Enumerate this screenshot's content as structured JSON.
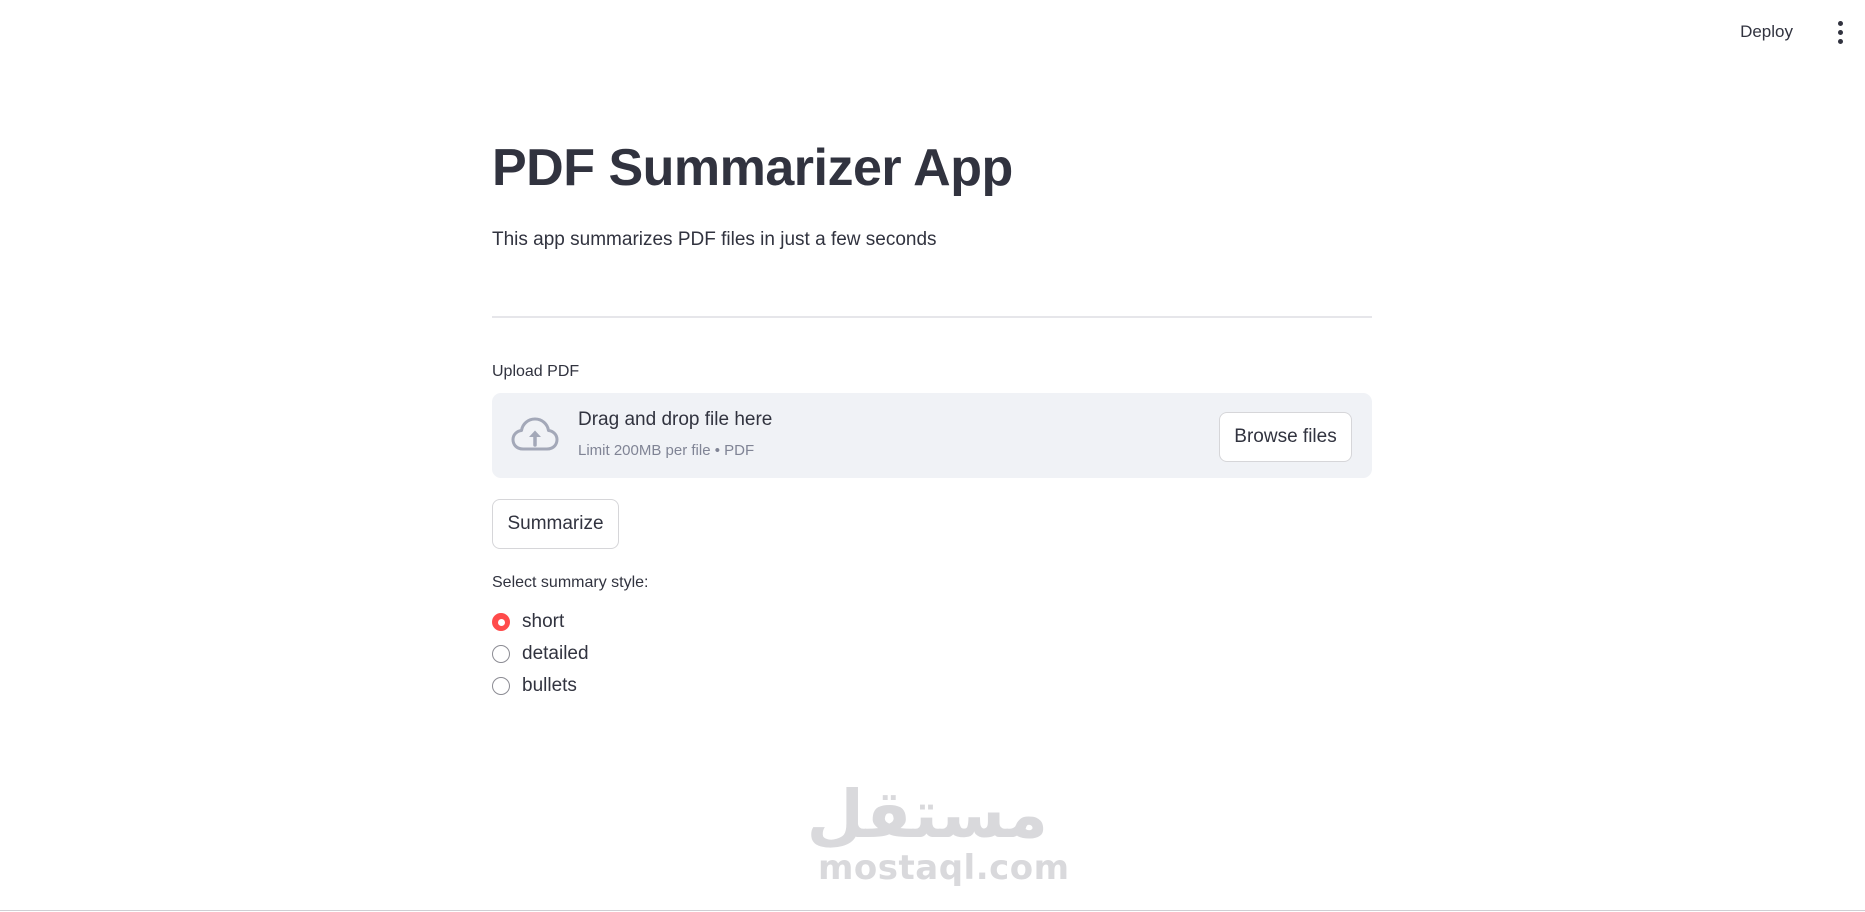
{
  "header": {
    "deploy_label": "Deploy",
    "menu_icon": "vertical-ellipsis-icon"
  },
  "main": {
    "title": "PDF Summarizer App",
    "subtitle": "This app summarizes PDF files in just a few seconds",
    "uploader": {
      "label": "Upload PDF",
      "icon": "cloud-upload-icon",
      "drop_text": "Drag and drop file here",
      "limit_text": "Limit 200MB per file • PDF",
      "browse_label": "Browse files"
    },
    "summarize_label": "Summarize",
    "summary_style": {
      "label": "Select summary style:",
      "options": [
        "short",
        "detailed",
        "bullets"
      ],
      "selected": "short"
    }
  },
  "colors": {
    "accent": "#ff4b4b",
    "text": "#31333f",
    "dropzone_bg": "#f0f2f6",
    "muted_text": "#808495"
  },
  "watermark": {
    "arabic": "مستقل",
    "latin": "mostaql.com"
  }
}
